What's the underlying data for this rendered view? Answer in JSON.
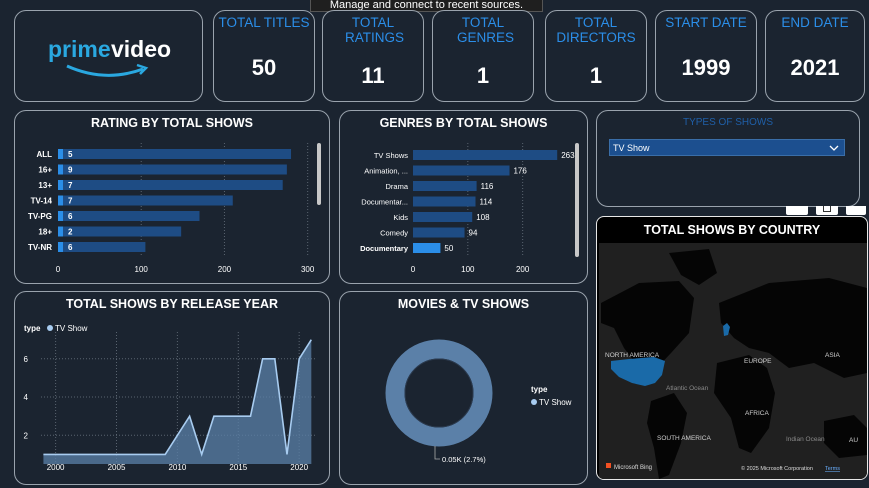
{
  "tooltip": "Manage and connect to recent sources.",
  "logo": {
    "text_prime": "prime",
    "text_video": "video"
  },
  "kpis": [
    {
      "title": "TOTAL TITLES",
      "value": "50"
    },
    {
      "title": "TOTAL RATINGS",
      "value": "11"
    },
    {
      "title": "TOTAL GENRES",
      "value": "1"
    },
    {
      "title": "TOTAL DIRECTORS",
      "value": "1"
    },
    {
      "title": "START DATE",
      "value": "1999"
    },
    {
      "title": "END DATE",
      "value": "2021"
    }
  ],
  "ratings_chart": {
    "title": "RATING BY TOTAL SHOWS",
    "chart_data": {
      "type": "bar",
      "orientation": "horizontal",
      "categories": [
        "ALL",
        "16+",
        "13+",
        "TV-14",
        "TV-PG",
        "18+",
        "TV-NR"
      ],
      "highlight": [
        5,
        9,
        7,
        7,
        6,
        2,
        6
      ],
      "values": [
        280,
        275,
        270,
        210,
        170,
        148,
        105
      ],
      "xticks": [
        0,
        100,
        200,
        300
      ],
      "xlim": [
        0,
        310
      ]
    }
  },
  "genres_chart": {
    "title": "GENRES BY TOTAL SHOWS",
    "chart_data": {
      "type": "bar",
      "orientation": "horizontal",
      "categories": [
        "TV Shows",
        "Animation, ...",
        "Drama",
        "Documentar...",
        "Kids",
        "Comedy",
        "Documentary"
      ],
      "values": [
        263,
        176,
        116,
        114,
        108,
        94,
        50
      ],
      "selected": "Documentary",
      "xticks": [
        0,
        100,
        200
      ],
      "xlim": [
        0,
        290
      ]
    }
  },
  "slicer": {
    "title": "TYPES OF SHOWS",
    "selected": "TV Show"
  },
  "release_chart": {
    "title": "TOTAL SHOWS BY RELEASE YEAR",
    "legend_title": "type",
    "legend_item": "TV Show",
    "chart_data": {
      "type": "area",
      "x": [
        1999,
        2009,
        2010,
        2011,
        2012,
        2013,
        2014,
        2015,
        2016,
        2017,
        2018,
        2019,
        2020,
        2021
      ],
      "values": [
        1,
        1,
        2,
        3,
        1,
        3,
        3,
        3,
        3,
        6,
        6,
        1,
        6,
        7
      ],
      "xticks": [
        2000,
        2005,
        2010,
        2015,
        2020
      ],
      "yticks": [
        2,
        4,
        6
      ],
      "xlim": [
        1998.8,
        2021.3
      ],
      "ylim": [
        0.5,
        7.4
      ]
    }
  },
  "donut": {
    "title": "MOVIES & TV SHOWS",
    "legend_title": "type",
    "legend_item": "TV Show",
    "label": "0.05K (2.7%)",
    "chart_data": {
      "type": "pie",
      "slices": [
        {
          "name": "TV Show",
          "value": 100
        }
      ]
    }
  },
  "map": {
    "title": "TOTAL SHOWS BY COUNTRY",
    "labels": [
      "NORTH AMERICA",
      "EUROPE",
      "ASIA",
      "Atlantic Ocean",
      "AFRICA",
      "SOUTH AMERICA",
      "Indian Ocean",
      "AU"
    ],
    "bing": "Microsoft Bing",
    "copyright": "© 2025 Microsoft Corporation",
    "terms": "Terms"
  },
  "colors": {
    "background": "#1b2430",
    "accent": "#2b8ee8",
    "bar": "#1e4c84",
    "bar_highlight": "#2b8ee8",
    "area": "#5b80a8"
  }
}
